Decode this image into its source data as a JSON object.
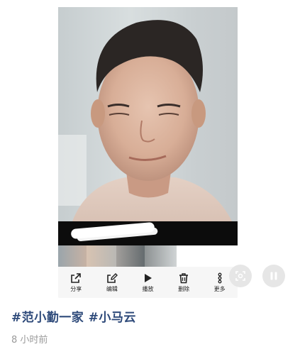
{
  "toolbar": {
    "items": [
      {
        "label": "分享",
        "icon": "share-icon"
      },
      {
        "label": "编辑",
        "icon": "edit-icon"
      },
      {
        "label": "播放",
        "icon": "play-icon"
      },
      {
        "label": "删除",
        "icon": "trash-icon"
      },
      {
        "label": "更多",
        "icon": "more-icon"
      }
    ]
  },
  "floating_buttons": [
    {
      "icon": "screenshot-icon"
    },
    {
      "icon": "pause-icon"
    }
  ],
  "caption": {
    "hashtags": [
      "#范小勤一家",
      "#小马云"
    ],
    "timestamp": "8 小时前"
  },
  "colors": {
    "hashtag": "#2e4a7a",
    "timestamp": "#9a9a9a",
    "toolbar_bg": "#f6f6f6"
  }
}
